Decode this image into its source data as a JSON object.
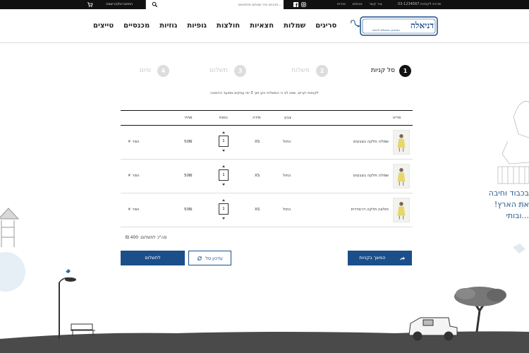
{
  "topbar": {
    "login_label": "התחברות/הרשמה",
    "search_placeholder": "תכניסו מה שאתם מחפשים...",
    "links": [
      "אודות",
      "סניפים",
      "צור קשר"
    ],
    "phone": "03-1234567 שירות לקוחות"
  },
  "header": {
    "logo_text": "דניאלה",
    "logo_subtitle": "הפתרון המושלם לאשה",
    "nav": [
      "סריגים",
      "שמלות",
      "חצאיות",
      "חולצות",
      "גופיות",
      "גוזיות",
      "מכנסיים",
      "טייצים"
    ]
  },
  "steps": [
    {
      "num": "1",
      "label": "סל קניות",
      "active": true
    },
    {
      "num": "2",
      "label": "משלוח",
      "active": false
    },
    {
      "num": "3",
      "label": "תשלום",
      "active": false
    },
    {
      "num": "4",
      "label": "סיום",
      "active": false
    }
  ],
  "notice": "לקוחות יקרים, שימו לב כי המשלוח יגיע תוך 3 ימי עסקים ממועד ההזמנה",
  "table": {
    "headers": {
      "product": "פריט",
      "color": "צבע",
      "size": "מידה",
      "qty": "כמות",
      "price": "מחיר"
    },
    "rows": [
      {
        "name": "שמלה חלקה בצבעים",
        "color": "כחול",
        "size": "XS",
        "qty": "1",
        "price": "50",
        "currency": "₪",
        "remove": "✕ הסר"
      },
      {
        "name": "שמלה חלקה בצבעים",
        "color": "כחול",
        "size": "XS",
        "qty": "1",
        "price": "50",
        "currency": "₪",
        "remove": "✕ הסר"
      },
      {
        "name": "חולצה חלקה דו־צדדית",
        "color": "כחול",
        "size": "XS",
        "qty": "1",
        "price": "50",
        "currency": "₪",
        "remove": "✕ הסר"
      }
    ]
  },
  "total": {
    "label": "סה\"כ לתשלום:",
    "value": "400",
    "currency": "₪"
  },
  "buttons": {
    "pay": "לתשלום",
    "update": "עדכון סל",
    "continue": "המשך בקניות"
  },
  "side_text": [
    "בכבוד וחיבה",
    "את הארץ!",
    "...ובותי"
  ],
  "colors": {
    "accent": "#1b4f8a",
    "dark": "#111111"
  }
}
